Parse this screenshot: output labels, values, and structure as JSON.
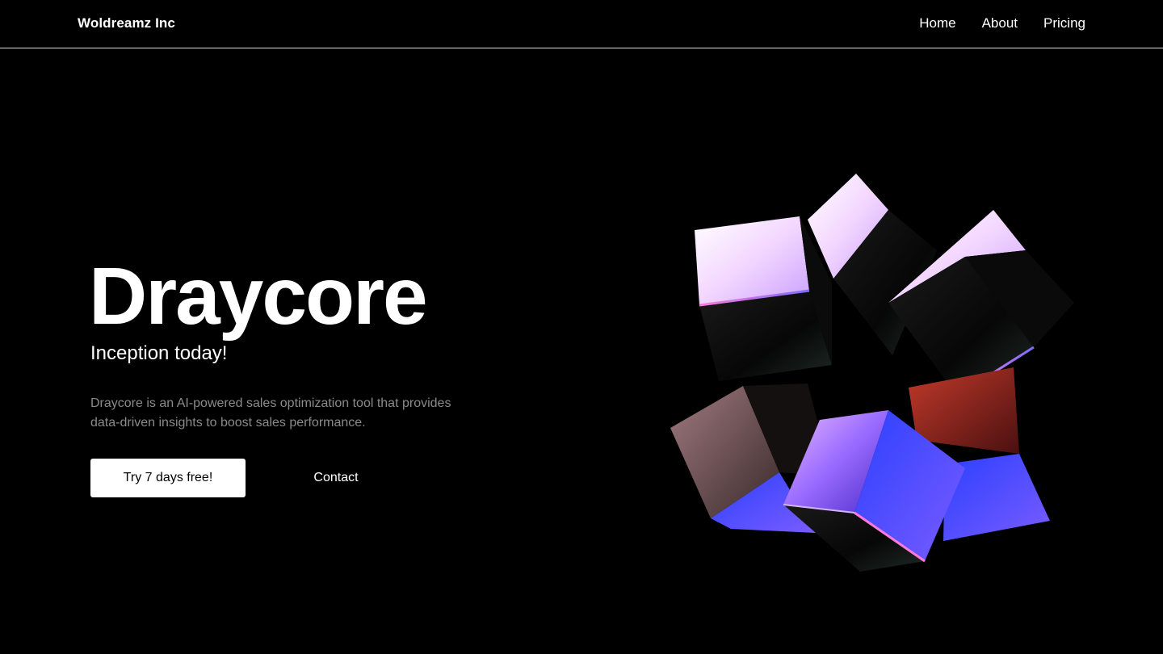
{
  "header": {
    "brand": "Woldreamz Inc",
    "nav": [
      {
        "label": "Home"
      },
      {
        "label": "About"
      },
      {
        "label": "Pricing"
      }
    ]
  },
  "hero": {
    "title": "Draycore",
    "subtitle": "Inception today!",
    "description": "Draycore is an AI-powered sales optimization tool that provides data-driven insights to boost sales performance.",
    "primary_cta": "Try 7 days free!",
    "secondary_cta": "Contact",
    "art_icon": "iridescent-cubes-cluster"
  },
  "colors": {
    "background": "#000000",
    "text": "#ffffff",
    "muted": "#8a8a8a",
    "accent_purple": "#8a5cff",
    "accent_pink": "#f2c8ff",
    "accent_blue": "#3a5bff",
    "accent_red": "#b33a2a"
  }
}
